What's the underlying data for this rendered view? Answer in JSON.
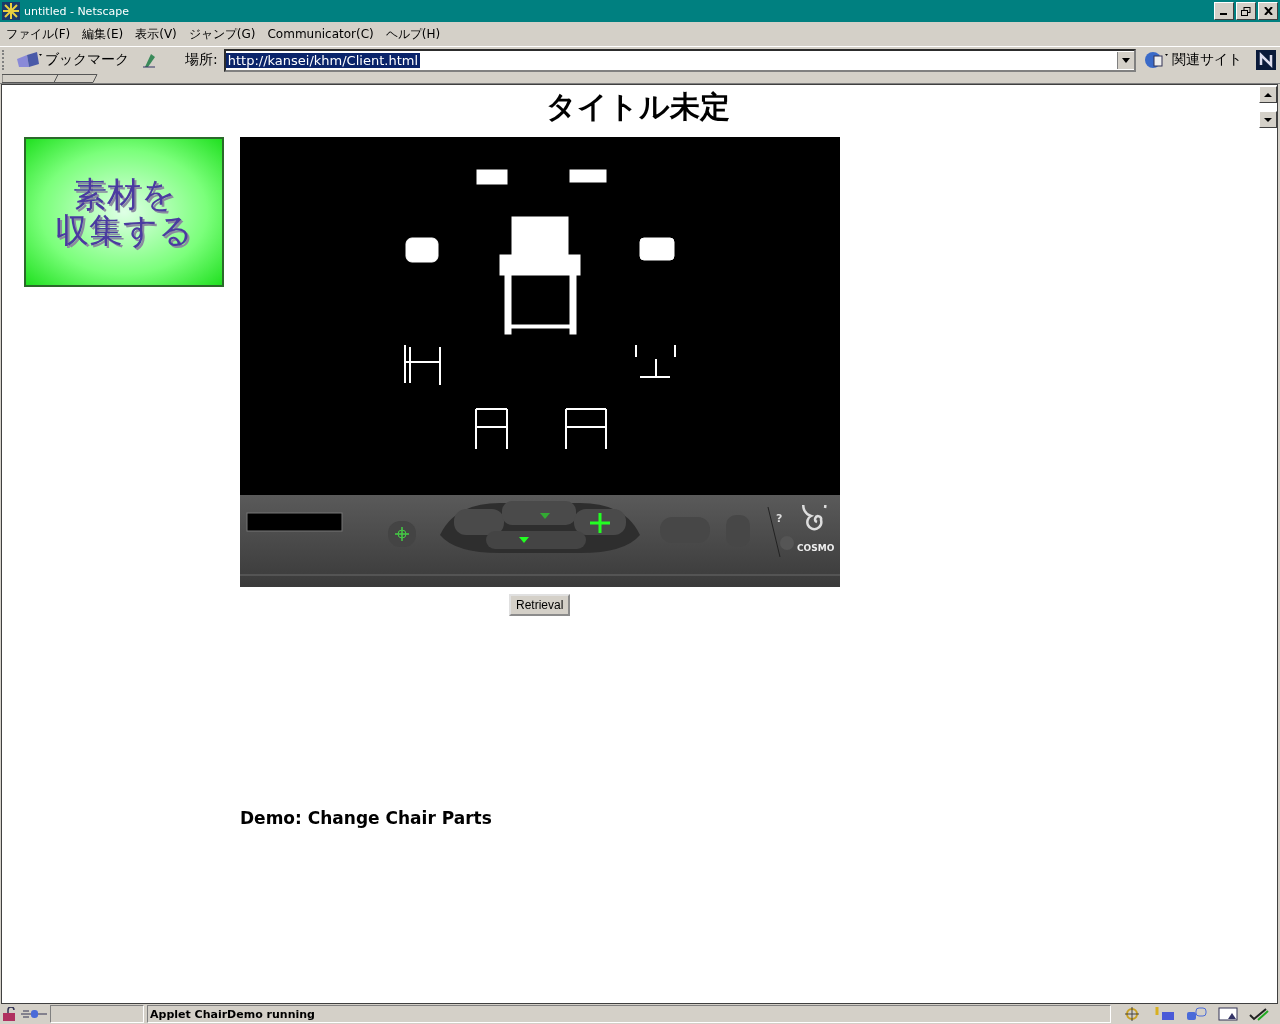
{
  "window": {
    "title": "untitled - Netscape"
  },
  "menu": [
    "ファイル(F)",
    "編集(E)",
    "表示(V)",
    "ジャンプ(G)",
    "Communicator(C)",
    "ヘルプ(H)"
  ],
  "toolbar": {
    "bookmarks": "ブックマーク",
    "location_label": "場所:",
    "url": "http://kansei/khm/Client.html",
    "url_selected": true,
    "related": "関連サイト"
  },
  "page": {
    "heading": "タイトル未定",
    "side_button": {
      "lines": [
        "素材を",
        "収集する"
      ]
    },
    "viewer": {
      "help": "?",
      "logo": "COSMO"
    },
    "retrieval_button": "Retrieval",
    "caption": "Demo: Change Chair Parts"
  },
  "status_bar": {
    "message": "Applet ChairDemo running"
  }
}
